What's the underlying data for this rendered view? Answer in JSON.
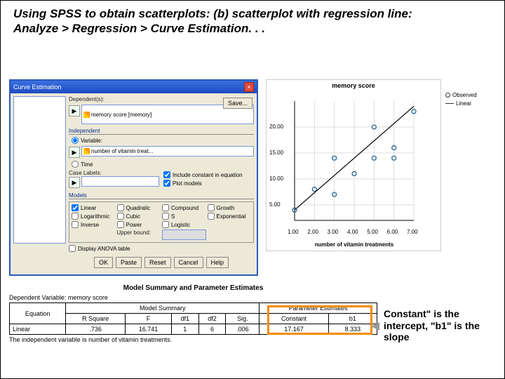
{
  "title_l1": "Using SPSS to obtain scatterplots: (b) scatterplot with regression line:",
  "title_l2": "Analyze > Regression > Curve Estimation. . .",
  "dialog": {
    "title": "Curve Estimation",
    "dep_label": "Dependent(s):",
    "dep_value": "memory score [memory]",
    "ind_label": "Independent",
    "ind_var": "Variable:",
    "ind_value": "number of vitamin treat...",
    "ind_time": "Time",
    "case_labels": "Case Labels:",
    "include_const": "Include constant in equation",
    "plot_models": "Plot models",
    "models_label": "Models",
    "models": [
      "Linear",
      "Quadratic",
      "Compound",
      "Growth",
      "Logarithmic",
      "Cubic",
      "S",
      "Exponential",
      "Inverse",
      "Power",
      "Logistic"
    ],
    "upper_bound": "Upper bound:",
    "display_anova": "Display ANOVA table",
    "save": "Save...",
    "buttons": [
      "OK",
      "Paste",
      "Reset",
      "Cancel",
      "Help"
    ]
  },
  "chart_data": {
    "type": "scatter",
    "title": "memory score",
    "xlabel": "number of vitamin treatments",
    "ylabel": "",
    "x": [
      1,
      2,
      3,
      3,
      4,
      5,
      5,
      6,
      6,
      7
    ],
    "y": [
      4,
      8,
      7,
      14,
      11,
      14,
      20,
      16,
      14,
      23
    ],
    "line": {
      "x1": 1,
      "y1": 4,
      "x2": 7,
      "y2": 24
    },
    "xticks": [
      "1.00",
      "2.00",
      "3.00",
      "4.00",
      "5.00",
      "6.00",
      "7.00"
    ],
    "yticks": [
      "5.00",
      "10.00",
      "15.00",
      "20.00"
    ],
    "xlim": [
      1,
      7
    ],
    "ylim": [
      2,
      25
    ],
    "legend": [
      "Observed",
      "Linear"
    ]
  },
  "table": {
    "title": "Model Summary and Parameter Estimates",
    "depvar": "Dependent Variable: memory score",
    "groups": [
      "Model Summary",
      "Parameter Estimates"
    ],
    "cols": [
      "Equation",
      "R Square",
      "F",
      "df1",
      "df2",
      "Sig.",
      "Constant",
      "b1"
    ],
    "row": [
      "Linear",
      ".736",
      "16.741",
      "1",
      "6",
      ".006",
      "17.167",
      "8.333"
    ],
    "footer": "The independent variable is number of vitamin treatments."
  },
  "note": "Constant\" is the intercept, \"b1\" is the slope"
}
